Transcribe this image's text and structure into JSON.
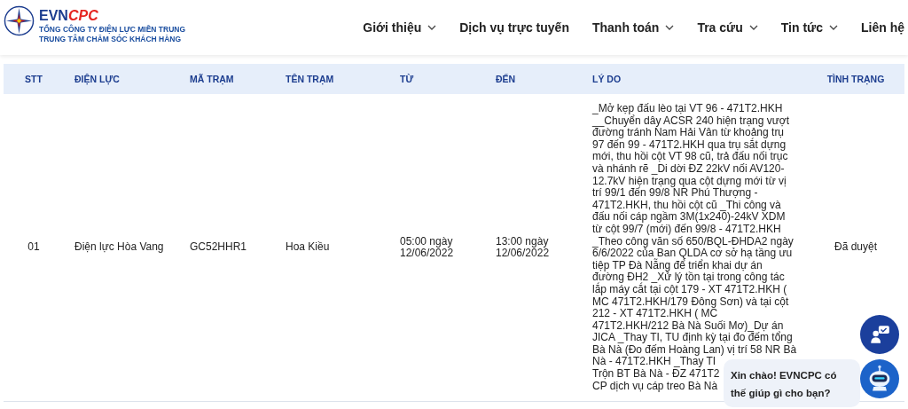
{
  "header": {
    "logo": {
      "brand_a": "EVN",
      "brand_b": "CPC",
      "line_1": "TỔNG CÔNG TY ĐIỆN LỰC MIỀN TRUNG",
      "line_2": "TRUNG TÂM CHĂM SÓC KHÁCH HÀNG"
    },
    "nav": [
      {
        "label": "Giới thiệu",
        "dropdown": true
      },
      {
        "label": "Dịch vụ trực tuyến",
        "dropdown": false
      },
      {
        "label": "Thanh toán",
        "dropdown": true
      },
      {
        "label": "Tra cứu",
        "dropdown": true
      },
      {
        "label": "Tin tức",
        "dropdown": true
      },
      {
        "label": "Liên hệ",
        "dropdown": false
      }
    ]
  },
  "table": {
    "columns": [
      "STT",
      "ĐIỆN LỰC",
      "MÃ TRẠM",
      "TÊN TRẠM",
      "TỪ",
      "ĐẾN",
      "LÝ DO",
      "TÌNH TRẠNG"
    ],
    "rows": [
      {
        "stt": "01",
        "dien_luc": "Điện lực Hòa Vang",
        "ma_tram": "GC52HHR1",
        "ten_tram": "Hoa Kiều",
        "tu": "05:00 ngày\n12/06/2022",
        "den": "13:00 ngày\n12/06/2022",
        "ly_do": [
          "_Mở kẹp đấu lèo tại VT 96 - 471T2.HKH\n__Chuyển dây ACSR 240 hiện trạng vượt\nđường tránh Nam Hải Vân từ khoảng trụ\n97 đến 99 - 471T2.HKH qua trụ sắt dựng\nmới, thu hồi cột VT 98 cũ, trả đấu nối trục\nvà nhánh rẽ _Di dời ĐZ 22kV nối AV120-\n12.7kV hiện trạng qua cột dựng mới từ vị\ntrí 99/1 đến 99/8 NR Phú Thượng -\n471T2.HKH, thu hồi cột cũ _Thi công và\nđấu nối cáp ngầm 3M(1x240)-24kV XDM\ntừ cột 99/7 (mới) đến 99/8 - 471T2.HKH\n_Theo công văn số 650/BQL-ĐHDA2 ngày\n6/6/2022 của Ban QLDA cơ sở hạ tầng ưu\ntiệp TP Đà Nẵng để triển khai dự án\nđường ĐH2 _Xử lý tồn tại trong công tác\nlắp máy cắt tại cột 179 - XT 471T2.HKH (\nMC 471T2.HKH/179 Đông Sơn) và tại cột\n212 - XT 471T2.HKH ( MC\n471T2.HKH/212 Bà Nà Suối Mơ)_Dự án\nJICA _Thay TI, TU định kỳ tại đo đếm tổng\nBà Nà (Đo đếm Hoàng Lan) vị trí 58 NR Bà",
          "Nà - 471T2.HKH _Thay TI\nTrộn BT Bà Nà - ĐZ 471T2\nCP dịch vụ cáp treo Bà Nà"
        ],
        "tinh_trang": "Đã duyệt"
      }
    ]
  },
  "chat": {
    "greeting": "Xin chào! EVNCPC có\nthế giúp gì cho bạn?"
  }
}
